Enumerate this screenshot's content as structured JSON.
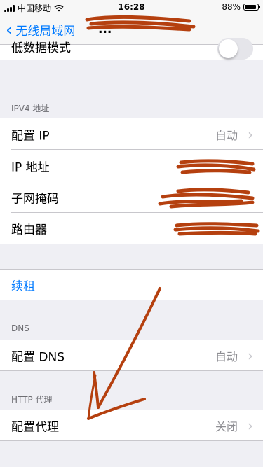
{
  "status_bar": {
    "carrier": "中国移动",
    "time": "16:28",
    "battery": "88%",
    "battery_level": 0.88
  },
  "nav": {
    "back_label": "无线局域网",
    "title_fragment": "..."
  },
  "low_data_mode": {
    "label": "低数据模式"
  },
  "ipv4": {
    "header": "IPV4 地址",
    "configure_ip": {
      "label": "配置 IP",
      "value": "自动"
    },
    "ip_address": {
      "label": "IP 地址"
    },
    "subnet_mask": {
      "label": "子网掩码"
    },
    "router": {
      "label": "路由器"
    }
  },
  "renew_lease": {
    "label": "续租"
  },
  "dns": {
    "header": "DNS",
    "configure": {
      "label": "配置 DNS",
      "value": "自动"
    }
  },
  "http_proxy": {
    "header": "HTTP 代理",
    "configure": {
      "label": "配置代理",
      "value": "关闭"
    }
  },
  "colors": {
    "accent": "#007aff",
    "annotation": "#b5400f",
    "background": "#efeff4"
  }
}
